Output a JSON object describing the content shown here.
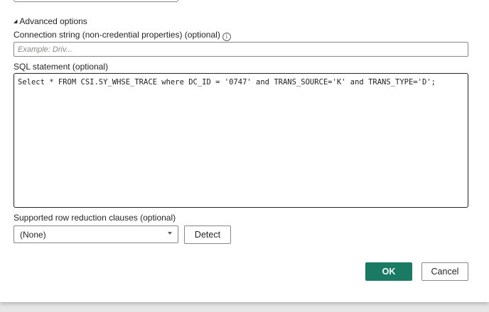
{
  "advanced": {
    "toggle_label": "Advanced options",
    "toggle_icon": "collapse-triangle-icon"
  },
  "connection_string": {
    "label": "Connection string (non-credential properties) (optional)",
    "info_icon": "info-icon",
    "placeholder": "Example: Driv...",
    "value": ""
  },
  "sql": {
    "label": "SQL statement (optional)",
    "value": "Select * FROM CSI.SY_WHSE_TRACE where DC_ID = '0747' and TRANS_SOURCE='K' and TRANS_TYPE='D';"
  },
  "row_reduction": {
    "label": "Supported row reduction clauses (optional)",
    "selected": "(None)",
    "detect_label": "Detect"
  },
  "footer": {
    "ok_label": "OK",
    "cancel_label": "Cancel"
  },
  "colors": {
    "primary": "#1a7a64",
    "border": "#8a8886",
    "text": "#252423"
  }
}
